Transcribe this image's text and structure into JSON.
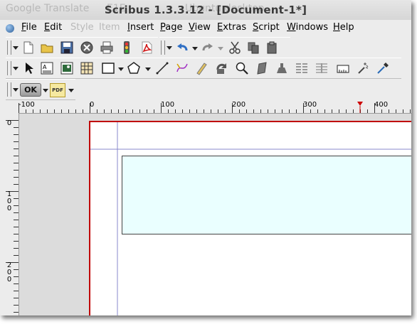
{
  "titlebar": {
    "title": "Scribus 1.3.3.12 - [Document-1*]",
    "ghost_left": "Google Translate",
    "ghost_mid": "E1E",
    "ghost_right": "Ubuntu desktop"
  },
  "menu": {
    "file": "File",
    "edit": "Edit",
    "style": "Style",
    "item": "Item",
    "insert": "Insert",
    "page": "Page",
    "view": "View",
    "extras": "Extras",
    "script": "Script",
    "windows": "Windows",
    "help": "Help"
  },
  "toolbar3": {
    "ok_label": "OK",
    "pdf_label": "PDF"
  },
  "ruler": {
    "h_labels": [
      "-100",
      "0",
      "100",
      "200",
      "300",
      "400"
    ],
    "v_labels": [
      "0",
      "1 0 0",
      "2 0 0"
    ]
  },
  "colors": {
    "page_border": "#c00000",
    "margin_guide": "#8080c0",
    "frame_fill": "#eaffff",
    "frame_border": "#444444",
    "ruler_marker": "#cc0000"
  }
}
